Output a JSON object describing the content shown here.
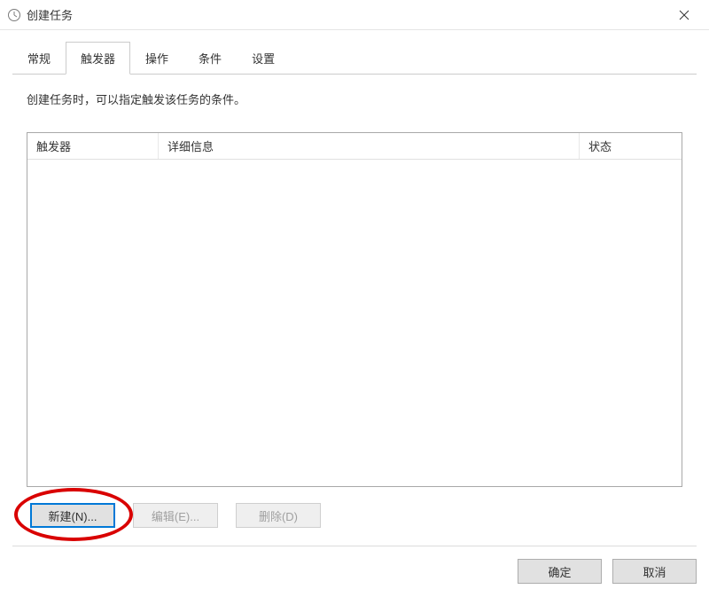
{
  "window": {
    "title": "创建任务"
  },
  "tabs": [
    {
      "label": "常规",
      "active": false
    },
    {
      "label": "触发器",
      "active": true
    },
    {
      "label": "操作",
      "active": false
    },
    {
      "label": "条件",
      "active": false
    },
    {
      "label": "设置",
      "active": false
    }
  ],
  "description": "创建任务时，可以指定触发该任务的条件。",
  "columns": {
    "trigger": "触发器",
    "detail": "详细信息",
    "status": "状态"
  },
  "buttons": {
    "new": "新建(N)...",
    "edit": "编辑(E)...",
    "delete": "删除(D)"
  },
  "dialog": {
    "ok": "确定",
    "cancel": "取消"
  }
}
